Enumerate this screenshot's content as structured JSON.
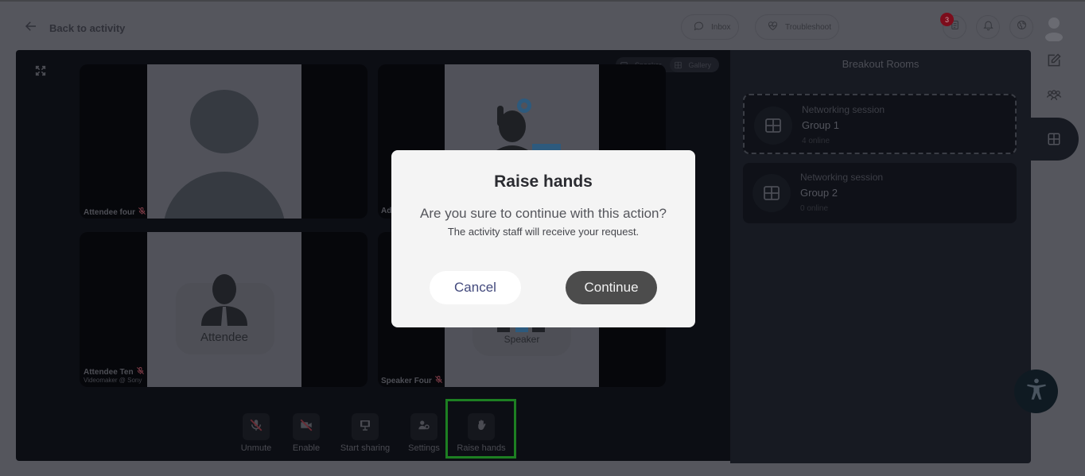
{
  "header": {
    "back_label": "Back to activity",
    "inbox_label": "Inbox",
    "troubleshoot_label": "Troubleshoot",
    "tasks_badge_count": "3"
  },
  "video": {
    "view_toggle": {
      "speaker_label": "Speaker",
      "gallery_label": "Gallery",
      "active": "Gallery"
    },
    "tiles": [
      {
        "name": "Attendee four",
        "subtitle": "",
        "muted": true,
        "avatar": "generic-person"
      },
      {
        "name": "Ad",
        "subtitle": "",
        "muted": true,
        "avatar": "support-agent"
      },
      {
        "name": "Attendee Ten",
        "subtitle": "Videomaker @ Sony",
        "muted": true,
        "avatar": "attendee-card",
        "card_label": "Attendee"
      },
      {
        "name": "Speaker Four",
        "subtitle": "",
        "muted": true,
        "avatar": "speaker-card",
        "card_label": "Speaker"
      }
    ],
    "controls": [
      {
        "label": "Unmute",
        "icon": "mic-off-icon"
      },
      {
        "label": "Enable",
        "icon": "camera-off-icon"
      },
      {
        "label": "Start sharing",
        "icon": "screen-share-icon"
      },
      {
        "label": "Settings",
        "icon": "user-settings-icon"
      },
      {
        "label": "Raise hands",
        "icon": "hand-icon",
        "highlighted": true
      }
    ]
  },
  "breakout": {
    "title": "Breakout Rooms",
    "rooms": [
      {
        "type": "Networking session",
        "name": "Group 1",
        "online": "4 online",
        "active": true
      },
      {
        "type": "Networking session",
        "name": "Group 2",
        "online": "0 online",
        "active": false
      }
    ]
  },
  "modal": {
    "title": "Raise hands",
    "question": "Are you sure to continue with this action?",
    "subtitle": "The activity staff will receive your request.",
    "cancel_label": "Cancel",
    "continue_label": "Continue"
  },
  "colors": {
    "highlight": "#1d7f22",
    "badge": "#7c0d1c",
    "continue_bg": "#4c4c4c",
    "cancel_text": "#434a7d"
  }
}
